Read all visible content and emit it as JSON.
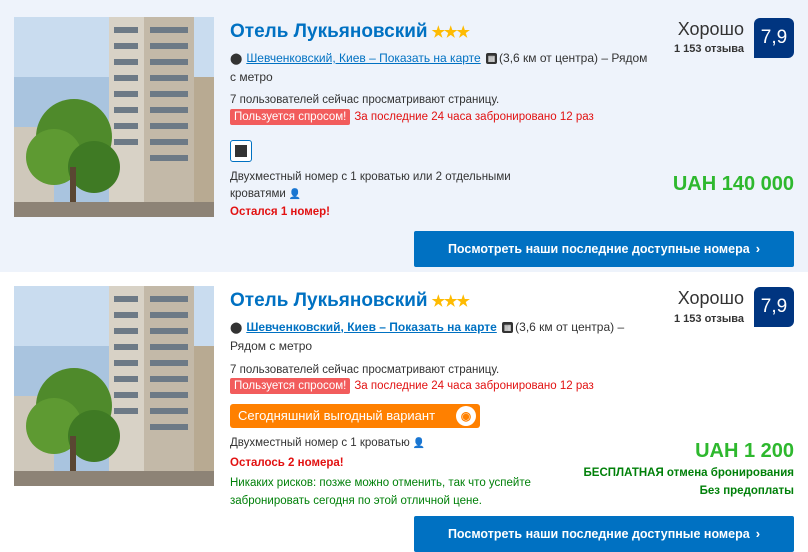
{
  "listings": [
    {
      "hotel_name": "Отель Лукьяновский",
      "stars": "★★★",
      "address_link": "Шевченковский, Киев – Показать на карте",
      "distance": "(3,6 км от центра)",
      "metro": "– Рядом с метро",
      "viewers": "7 пользователей сейчас просматривают страницу.",
      "demand_badge": "Пользуется спросом!",
      "demand_text": "За последние 24 часа забронировано 12 раз",
      "room": "Двухместный номер с 1 кроватью или 2 отдельными кроватями",
      "rooms_left": "Остался 1 номер!",
      "score_word": "Хорошо",
      "reviews": "1 153 отзыва",
      "score": "7,9",
      "price": "UAH 140 000",
      "cta": "Посмотреть наши последние доступные номера"
    },
    {
      "hotel_name": "Отель Лукьяновский",
      "stars": "★★★",
      "address_link": "Шевченковский, Киев – Показать на карте",
      "distance": "(3,6 км от центра)",
      "metro": "– Рядом с метро",
      "viewers": "7 пользователей сейчас просматривают страницу.",
      "demand_badge": "Пользуется спросом!",
      "demand_text": "За последние 24 часа забронировано 12 раз",
      "deal_badge": "Сегодняшний выгодный вариант",
      "room": "Двухместный номер с 1 кроватью",
      "rooms_left": "Осталось 2 номера!",
      "no_risk": "Никаких рисков: позже можно отменить, так что успейте забронировать сегодня по этой отличной цене.",
      "score_word": "Хорошо",
      "reviews": "1 153 отзыва",
      "score": "7,9",
      "price": "UAH 1 200",
      "free_cancel": "БЕСПЛАТНАЯ отмена бронирования",
      "no_prepay": "Без предоплаты",
      "cta": "Посмотреть наши последние доступные номера"
    }
  ],
  "colors": {
    "brand_blue": "#0071c2",
    "score_blue": "#003580",
    "price_green": "#2eb82e",
    "alert_red": "#e21111",
    "deal_orange": "#ff8000",
    "star_yellow": "#febb02"
  }
}
